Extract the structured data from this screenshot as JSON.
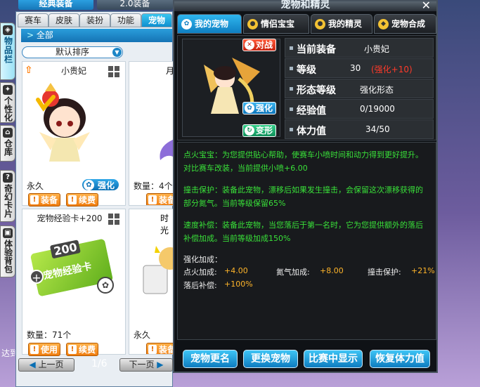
{
  "top_tabs": [
    "经典装备",
    "2.0装备"
  ],
  "side_tabs": [
    "物品栏",
    "个性化",
    "仓库",
    "奇幻卡片",
    "体验背包"
  ],
  "inventory": {
    "tabs": [
      "赛车",
      "皮肤",
      "装扮",
      "功能",
      "宠物"
    ],
    "all_label": "全部",
    "sort_label": "默认排序",
    "items": [
      {
        "name": "小贵妃",
        "duration": "永久",
        "badge": "强化",
        "buttons": [
          "装备",
          "续费"
        ]
      },
      {
        "name": "月",
        "qty": "数量：4个",
        "buttons": [
          "装备"
        ]
      },
      {
        "name": "宠物经验卡+200",
        "qty": "数量：71个",
        "card_text": "200",
        "card_text2": "宠物经验卡",
        "buttons": [
          "使用",
          "续费"
        ]
      },
      {
        "name": "时光",
        "duration": "永久",
        "buttons": [
          "装备"
        ]
      }
    ],
    "pager": {
      "prev": "上一页",
      "page": "1/6",
      "next": "下一页"
    },
    "bottom_text": "达到"
  },
  "dialog": {
    "title": "宠物和精灵",
    "tabs": [
      "我的宠物",
      "情侣宝宝",
      "我的精灵",
      "宠物合成"
    ],
    "tags": {
      "battle": "对战",
      "enhance": "强化",
      "transform": "变形"
    },
    "info": {
      "current_equip_label": "当前装备",
      "current_equip_value": "小贵妃",
      "level_label": "等级",
      "level_value": "30",
      "level_bonus": "(强化+10)",
      "form_label": "形态等级",
      "form_value": "强化形态",
      "exp_label": "经验值",
      "exp_value": "0/19000",
      "stamina_label": "体力值",
      "stamina_value": "34/50"
    },
    "skills": [
      "点火宝宝：为您提供贴心帮助，使赛车小喷时间和动力得到更好提升。对比赛车改装，当前提供小喷+6.00",
      "撞击保护：装备此宠物，漂移后如果发生撞击，会保留这次漂移获得的部分氮气。当前等级保留65%",
      "速度补偿：装备此宠物，当您落后于第一名时，它为您提供额外的落后补偿加成。当前等级加成150%"
    ],
    "enhance_title": "强化加成：",
    "enhance_stats": [
      {
        "label": "点火加成:",
        "value": "+4.00"
      },
      {
        "label": "氮气加成:",
        "value": "+8.00"
      },
      {
        "label": "撞击保护:",
        "value": "+21%"
      },
      {
        "label": "落后补偿:",
        "value": "+100%"
      }
    ],
    "buttons": [
      "宠物更名",
      "更换宠物",
      "比赛中显示",
      "恢复体力值"
    ]
  }
}
